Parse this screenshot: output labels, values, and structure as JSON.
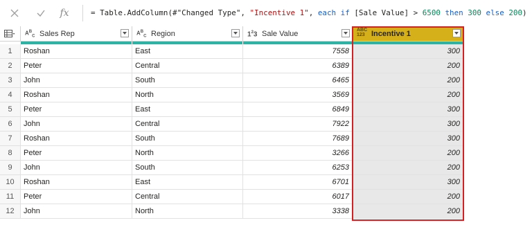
{
  "formula": {
    "cancel_icon": "close-icon",
    "commit_icon": "check-icon",
    "fx_label": "fx",
    "parts": [
      {
        "cls": "",
        "text": "= Table.AddColumn(#\"Changed Type\", "
      },
      {
        "cls": "str",
        "text": "\"Incentive 1\""
      },
      {
        "cls": "",
        "text": ", "
      },
      {
        "cls": "kw",
        "text": "each if"
      },
      {
        "cls": "",
        "text": " [Sale Value] > "
      },
      {
        "cls": "num",
        "text": "6500"
      },
      {
        "cls": "",
        "text": " "
      },
      {
        "cls": "kw",
        "text": "then"
      },
      {
        "cls": "",
        "text": " "
      },
      {
        "cls": "num",
        "text": "300"
      },
      {
        "cls": "",
        "text": " "
      },
      {
        "cls": "kw",
        "text": "else"
      },
      {
        "cls": "",
        "text": " "
      },
      {
        "cls": "num",
        "text": "200"
      },
      {
        "cls": "",
        "text": ")"
      }
    ]
  },
  "table": {
    "columns": [
      {
        "label": "Sales Rep",
        "type_icon": "ABC",
        "type": "text"
      },
      {
        "label": "Region",
        "type_icon": "ABC",
        "type": "text"
      },
      {
        "label": "Sale Value",
        "type_icon": "123",
        "type": "number"
      },
      {
        "label": "Incentive 1",
        "type_icon": "ABC123",
        "type": "any"
      }
    ],
    "rows": [
      {
        "n": "1",
        "rep": "Roshan",
        "region": "East",
        "sale": "7558",
        "inc": "300"
      },
      {
        "n": "2",
        "rep": "Peter",
        "region": "Central",
        "sale": "6389",
        "inc": "200"
      },
      {
        "n": "3",
        "rep": "John",
        "region": "South",
        "sale": "6465",
        "inc": "200"
      },
      {
        "n": "4",
        "rep": "Roshan",
        "region": "North",
        "sale": "3569",
        "inc": "200"
      },
      {
        "n": "5",
        "rep": "Peter",
        "region": "East",
        "sale": "6849",
        "inc": "300"
      },
      {
        "n": "6",
        "rep": "John",
        "region": "Central",
        "sale": "7922",
        "inc": "300"
      },
      {
        "n": "7",
        "rep": "Roshan",
        "region": "South",
        "sale": "7689",
        "inc": "300"
      },
      {
        "n": "8",
        "rep": "Peter",
        "region": "North",
        "sale": "3266",
        "inc": "200"
      },
      {
        "n": "9",
        "rep": "John",
        "region": "South",
        "sale": "6253",
        "inc": "200"
      },
      {
        "n": "10",
        "rep": "Roshan",
        "region": "East",
        "sale": "6701",
        "inc": "300"
      },
      {
        "n": "11",
        "rep": "Peter",
        "region": "Central",
        "sale": "6017",
        "inc": "200"
      },
      {
        "n": "12",
        "rep": "John",
        "region": "North",
        "sale": "3338",
        "inc": "200"
      }
    ]
  },
  "colors": {
    "quality_bar": "#2bb3a6",
    "selected_header": "#d6b01a",
    "selected_column": "#e8e8e8",
    "highlight_outline": "#d42020"
  }
}
